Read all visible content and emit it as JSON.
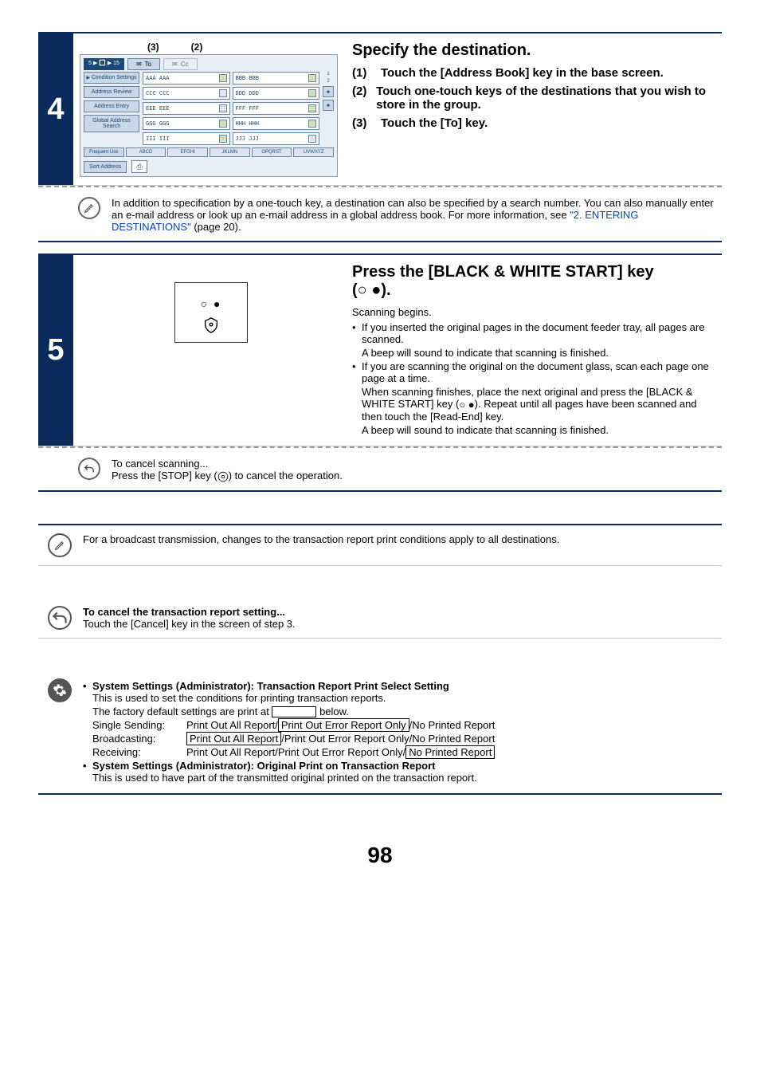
{
  "step4": {
    "num": "4",
    "label3": "(3)",
    "label2": "(2)",
    "crumb": "5 ▶ 🔳 ▶ 15",
    "to": "To",
    "cc": "Cc",
    "side": {
      "cond": "Condition Settings",
      "review": "Address Review",
      "entry": "Address Entry",
      "global": "Global Address Search"
    },
    "cells": [
      "AAA AAA",
      "BBB BBB",
      "CCC CCC",
      "DDD DDD",
      "EEE EEE",
      "FFF FFF",
      "GGG GGG",
      "HHH HHH",
      "III III",
      "JJJ JJJ"
    ],
    "page1": "1",
    "page2": "2",
    "tabs": [
      "Frequent Use",
      "ABCD",
      "EFGHI",
      "JKLMN",
      "OPQRST",
      "UVWXYZ"
    ],
    "sort": "Sort Address",
    "heading": "Specify the destination.",
    "i1n": "(1)",
    "i1": "Touch the [Address Book] key in the base screen.",
    "i2n": "(2)",
    "i2": "Touch one-touch keys of the destinations that you wish to store in the group.",
    "i3n": "(3)",
    "i3": "Touch the [To] key.",
    "note_a": "In addition to specification by a one-touch key, a destination can also be specified by a search number. You can also manually enter an e-mail address or look up an e-mail address in a global address book. For more information, see ",
    "note_link": "\"2. ENTERING DESTINATIONS\"",
    "note_b": " (page 20)."
  },
  "step5": {
    "num": "5",
    "heading_a": "Press the [BLACK & WHITE START] key",
    "heading_b": "(",
    "heading_c": ").",
    "p1": "Scanning begins.",
    "li1": "If you inserted the original pages in the document feeder tray, all pages are scanned.",
    "li1b": "A beep will sound to indicate that scanning is finished.",
    "li2": "If you are scanning the original on the document glass, scan each page one page at a time.",
    "li2b": "When scanning finishes, place the next original and press the [BLACK & WHITE START] key (",
    "li2b2": "). Repeat until all pages have been scanned and then touch the [Read-End] key.",
    "li2c": "A beep will sound to indicate that scanning is finished.",
    "cancel_t": "To cancel scanning...",
    "cancel_b1": "Press the [STOP] key (",
    "cancel_b2": ") to cancel the operation."
  },
  "bottom": {
    "broadcast": "For a broadcast transmission, changes to the transaction report print conditions apply to all destinations.",
    "cancel_t": "To cancel the transaction report setting...",
    "cancel_b": "Touch the [Cancel] key in the screen of step 3.",
    "sys1_t": "System Settings (Administrator): Transaction Report Print Select Setting",
    "sys1_a": "This is used to set the conditions for printing transaction reports.",
    "sys1_b1": "The factory default settings are print at ",
    "sys1_b2": " below.",
    "row1_l": "Single Sending:",
    "row1_a": "Print Out All Report/",
    "row1_hl": "Print Out Error Report Only",
    "row1_b": "/No Printed Report",
    "row2_l": "Broadcasting:",
    "row2_hl": "Print Out All Report",
    "row2_b": "/Print Out Error Report Only/No Printed Report",
    "row3_l": "Receiving:",
    "row3_a": "Print Out All Report/Print Out Error Report Only/",
    "row3_hl": "No Printed Report",
    "sys2_t": "System Settings (Administrator): Original Print on Transaction Report",
    "sys2_a": "This is used to have part of the transmitted original printed on the transaction report."
  },
  "page_num": "98"
}
